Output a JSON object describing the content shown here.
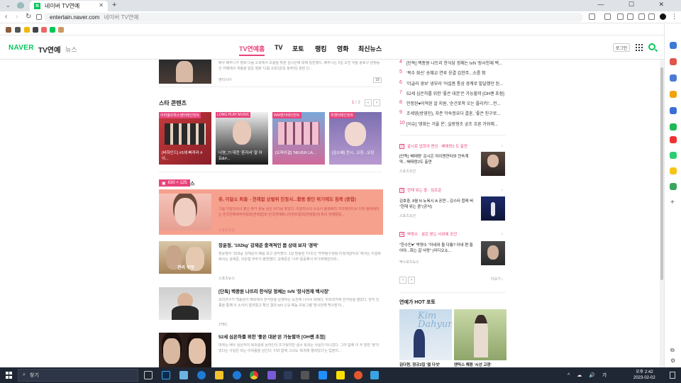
{
  "browser": {
    "tab_title": "네이버 TV연예",
    "tab_favicon": "N",
    "url": "entertain.naver.com",
    "url_page_title": "네이버 TV연예",
    "window_controls": "— ☐ ✕"
  },
  "header": {
    "logo": "NAVER",
    "section": "TV연예",
    "news": "뉴스",
    "nav": [
      "TV연예홈",
      "TV",
      "포토",
      "랭킹",
      "영화",
      "최신뉴스"
    ],
    "login": "로그인"
  },
  "top_article": {
    "desc": "배우 배두나가 영화 다음 소희에서 초롱을 맞춘 김시은에 대해 칭찬했다. 배두나는 2일 오전 서울 종로구 삼청동 인 카페에서 개봉을 앞둔 영화 '다음 소희'(감독 정주리) 관련 인...",
    "source": "엔터시아",
    "comments": "18"
  },
  "star_content": {
    "title": "스타 콘텐츠",
    "page": "1",
    "total": "2",
    "cards": [
      {
        "label": "어려울뜨하스엔터테인먼트",
        "caption": "[비하인드] #1에 빠져라 #이...",
        "color": "#e8437b"
      },
      {
        "label": "LONG PLAY MUSIC",
        "caption": "나영_TI 대전 '혼자서' 잘 어요&#...",
        "color": "#e8437b"
      },
      {
        "label": "WM엔터테인먼트",
        "caption": "[오마이걸] 'NEVER LA...",
        "color": "#e8437b"
      },
      {
        "label": "위엔터테인먼트",
        "caption": "[김소혜] 전시...오징...오징",
        "color": "#e8437b"
      }
    ]
  },
  "badge": {
    "size_label": "630 × 125",
    "section_suffix": "스"
  },
  "articles": [
    {
      "title": "츄, 이달소 퇴출→전례없 상벌위 진정서...활동 중단 위기에도 침묵 (종합)",
      "desc": "그룹 이달의소녀 출신 츄가 활동 중단 위기를 맞았다. 이달의소녀 소속사 블록베리 크리에이티브 이하 블록베리는 한국연예제작자협회(연제협)와 한국연예매니지먼트협회(연매협)에 츄의 연예활동...",
      "source": "스포츠조선",
      "highlight": true
    },
    {
      "title": "장윤정, '102kg' 강재준 충격적인 몸 상태 보자 '경악'",
      "desc": "장윤정이 '102kg' 강재준의 배를 보고 경악했다. 1일 방송된 TV조선 '부부탐구생활-이렇게살아요' 에서는 이설화에서는 강재준, 이은형 부부가 출연했다. 강재준은 '너무 뚱뚱해서 무기력해진다라...",
      "source": "스포츠뉴스",
      "thumb_caption": "관리 무엇"
    },
    {
      "title": "[단독] 백종원 나뜨리 한식당 정체는 tvN '장사천재 백사장'",
      "desc": "요리연구가 백종원이 해외에서 한식당을 운영하는 도전에 나서서 화제다. 아프리카에 한식당을 열었다. 현지 인종을 통해 이 소식이 알려졌고 확인 결과 tvN 신규 예능 프로그램 '장사천재 백사장'이...",
      "source": "JTBC"
    },
    {
      "title": "52세 심은하를 위한 '좋은 대본'은 가능할까 [OH쎈 초점]",
      "desc": "데뷔는 배우 심은하의 복귀설로 몬라인이 뜨거웠지만 결국 복귀는 사실이 아니었다. 그러 합해 이 두 판만 '쌓'이었다는 사실은 되는 아쉬움을 남긴다. 이와 함께 그녀도 '복귀에 열려있다'는 입장이...",
      "source": ""
    }
  ],
  "ranking": [
    {
      "n": "4",
      "text": "[단독] 백종원 나뜨리 한식당 정체는 tvN '장사천재 백..."
    },
    {
      "n": "5",
      "text": "'복수 화신' 송혜교·연루 응결 김한주...소름 확"
    },
    {
      "n": "6",
      "text": "'더글라 경보' 냉부라 '어설픔 통상 경계로 발달했던 된..."
    },
    {
      "n": "7",
      "text": "52세 심은하를 위한 '좋은 대본'은 가능할까 [OH쎈 초점]"
    },
    {
      "n": "8",
      "text": "안정된♥이혁된 알 지원, '순간포착 오는 플리키!'...전..."
    },
    {
      "n": "9",
      "text": "조세영(방영진), 자존 악숙정요다 결혼, '좋은 친구로..."
    },
    {
      "n": "10",
      "text": "[이슈] '영화는 거울 온', 실랑형조 궁조 흐른 거워해..."
    }
  ],
  "right_sections": [
    {
      "num": "2",
      "header": "같시로 업희야 앤신 · 배태랑2 도 출연",
      "title": "[단독] '배태랑' 김시은 자이엔연타와 전속계약...'배태랑2도 출연",
      "source": "스포츠조선"
    },
    {
      "num": "3",
      "header": "현재 위는 중 · 임조준",
      "title": "김호중, 8월 N 뉴욕시·A 공연→김스타 합래 버 \"현재 위는 중\"(공식)",
      "source": "스포츠조선"
    },
    {
      "num": "4",
      "header": "박명수 · 꿈은 받는 사위에 조언",
      "title": "\"한수민♥\" 박명수 \"아내와 둘 다툼? 아내 편 들어야...화는 갈 사랑\" (라디오쇼...",
      "source": "엑스포츠뉴스"
    }
  ],
  "right_more": "더보기 ›",
  "hot_photo": {
    "title": "연예가 HOT 포토",
    "captions": [
      "김다현, 정규2집 '열 다섯'",
      "엔믹스 해원 '시선 고정'"
    ],
    "overlay_text": "Kim\nDahyun"
  },
  "taskbar": {
    "search_placeholder": "찾기",
    "time": "오후 2:42",
    "date": "2023-02-02",
    "tray": "^ ☁ 🔊 가"
  }
}
